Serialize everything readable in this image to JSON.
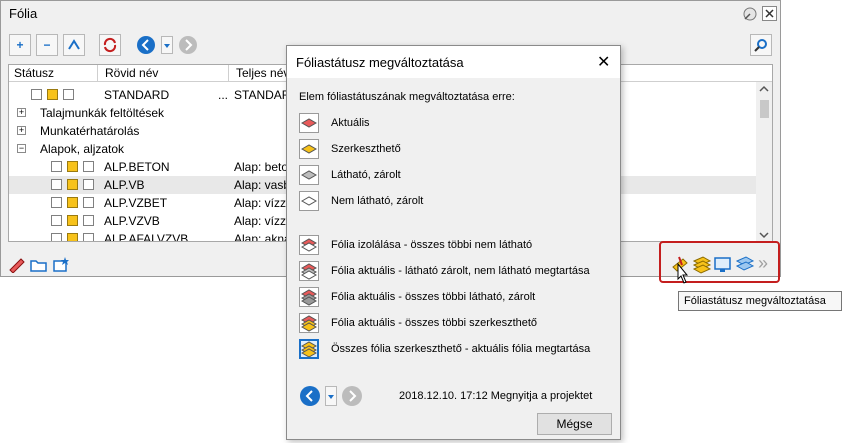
{
  "window": {
    "title": "Fólia"
  },
  "columns": {
    "status": "Státusz",
    "short_name": "Rövid név",
    "full_name": "Teljes név"
  },
  "rows": [
    {
      "short": "STANDARD",
      "extra": "...",
      "full": "STANDARD"
    },
    {
      "group": "Talajmunkák feltöltések"
    },
    {
      "group": "Munkatérhatárolás"
    },
    {
      "group": "Alapok, aljzatok"
    },
    {
      "short": "ALP.BETON",
      "full": "Alap: beto"
    },
    {
      "short": "ALP.VB",
      "full": "Alap: vasb"
    },
    {
      "short": "ALP.VZBET",
      "full": "Alap: vízzá"
    },
    {
      "short": "ALP.VZVB",
      "full": "Alap: vízzá"
    },
    {
      "short": "ALP.AFALVZVB",
      "full": "Alap: akna"
    }
  ],
  "expanders": {
    "plus": "+",
    "minus": "−"
  },
  "dialog": {
    "title": "Fóliastátusz megváltoztatása",
    "close": "✕",
    "prompt": "Elem fóliastátuszának megváltoztatása erre:",
    "status_options": [
      "Aktuális",
      "Szerkeszthető",
      "Látható, zárolt",
      "Nem látható, zárolt"
    ],
    "actions": [
      "Fólia izolálása - összes többi nem látható",
      "Fólia aktuális - látható zárolt, nem látható megtartása",
      "Fólia aktuális - összes többi látható, zárolt",
      "Fólia aktuális - összes többi szerkeszthető",
      "Összes fólia szerkeszthető - aktuális fólia megtartása"
    ],
    "history": "2018.12.10. 17:12 Megnyitja a projektet",
    "cancel": "Mégse"
  },
  "tooltip": "Fóliastátusz megváltoztatása",
  "toolbar_glyphs": {
    "add": "+",
    "remove": "−",
    "more": "»"
  },
  "colors": {
    "highlight": "#c41e1e",
    "status_yellow": "#f7c21a",
    "status_red": "#e85a5a",
    "accent_blue": "#1a6fc7"
  }
}
